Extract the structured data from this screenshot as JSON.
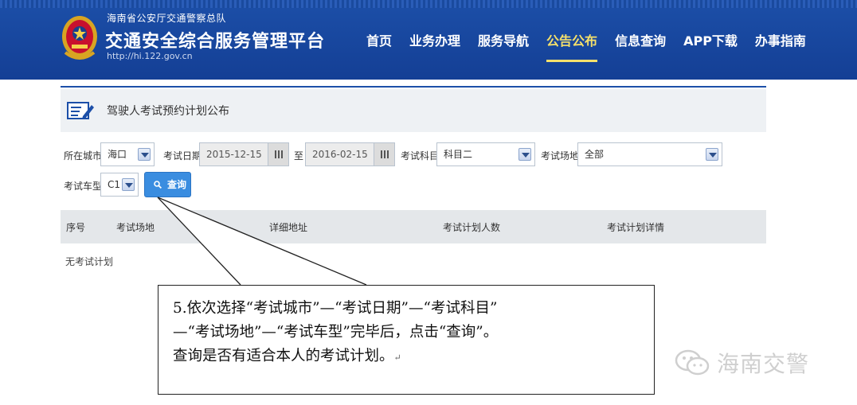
{
  "header": {
    "org_name": "海南省公安厅交通警察总队",
    "platform_title": "交通安全综合服务管理平台",
    "site_url": "http://hi.122.gov.cn",
    "nav": [
      {
        "label": "首页"
      },
      {
        "label": "业务办理"
      },
      {
        "label": "服务导航"
      },
      {
        "label": "公告公布",
        "active": true
      },
      {
        "label": "信息查询"
      },
      {
        "label": "APP下载"
      },
      {
        "label": "办事指南"
      }
    ],
    "brand_color": "#1c4fa8",
    "active_color": "#f5e06b"
  },
  "section": {
    "title": "驾驶人考试预约计划公布",
    "icon": "form-edit-icon"
  },
  "form": {
    "city_label": "所在城市",
    "city_value": "海口",
    "date_label": "考试日期",
    "date_from": "2015-12-15",
    "date_sep": "至",
    "date_to": "2016-02-15",
    "subject_label": "考试科目",
    "subject_value": "科目二",
    "venue_label": "考试场地",
    "venue_value": "全部",
    "vehicle_label": "考试车型",
    "vehicle_value": "C1",
    "query_button": "查询",
    "button_color": "#3a8de0"
  },
  "table": {
    "headers": [
      "序号",
      "考试场地",
      "详细地址",
      "考试计划人数",
      "考试计划详情"
    ],
    "empty_message": "无考试计划"
  },
  "annotation": {
    "line1": "5.依次选择“考试城市”—“考试日期”—“考试科目”",
    "line2": "—“考试场地”—“考试车型”完毕后，点击“查询”。",
    "line3": "查询是否有适合本人的考试计划。",
    "pilcrow": "↵"
  },
  "watermark": {
    "text": "海南交警",
    "icon": "wechat-icon"
  }
}
